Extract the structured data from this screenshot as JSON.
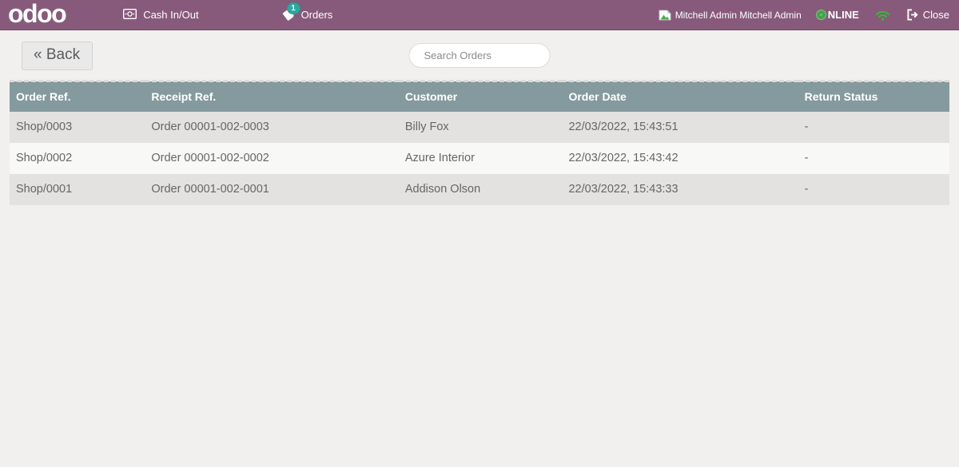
{
  "navbar": {
    "logo": "odoo",
    "cash_button_label": "Cash In/Out",
    "orders_button_label": "Orders",
    "orders_badge_count": "1",
    "username": "Mitchell Admin Mitchell Admin",
    "status_label": "NLINE",
    "close_button_label": "Close"
  },
  "toolbar": {
    "back_label": "« Back",
    "search_placeholder": "Search Orders"
  },
  "orders_table": {
    "columns": [
      "Order Ref.",
      "Receipt Ref.",
      "Customer",
      "Order Date",
      "Return Status"
    ],
    "rows": [
      {
        "order_ref": "Shop/0003",
        "receipt_ref": "Order 00001-002-0003",
        "customer": "Billy Fox",
        "order_date": "22/03/2022, 15:43:51",
        "return_status": "-"
      },
      {
        "order_ref": "Shop/0002",
        "receipt_ref": "Order 00001-002-0002",
        "customer": "Azure Interior",
        "order_date": "22/03/2022, 15:43:42",
        "return_status": "-"
      },
      {
        "order_ref": "Shop/0001",
        "receipt_ref": "Order 00001-002-0001",
        "customer": "Addison Olson",
        "order_date": "22/03/2022, 15:43:33",
        "return_status": "-"
      }
    ]
  },
  "icons": {
    "cash": "banknote-icon",
    "orders": "ticket-tag-icon",
    "avatar": "broken-image-icon",
    "status": "online-dot-icon",
    "wifi": "wifi-icon",
    "close": "sign-out-icon"
  },
  "colors": {
    "navbar_bg": "#875A7B",
    "badge_teal": "#2fa79d",
    "table_header_bg": "#859a9e",
    "online_green": "#49a14d",
    "wifi_green": "#3fae3f"
  }
}
